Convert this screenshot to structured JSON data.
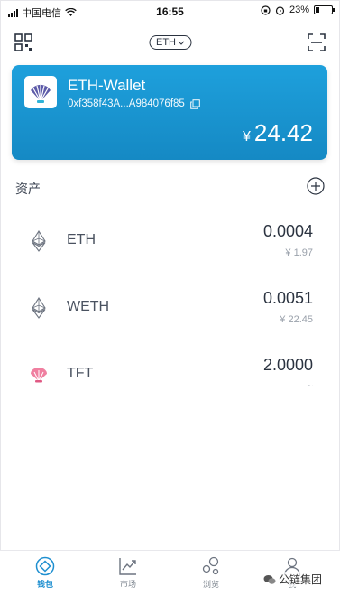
{
  "status_bar": {
    "carrier": "中国电信",
    "time": "16:55",
    "battery": "23%",
    "battery_level": 0.23
  },
  "header": {
    "network": "ETH"
  },
  "wallet": {
    "name": "ETH-Wallet",
    "address": "0xf358f43A...A984076f85",
    "currency_symbol": "¥",
    "balance": "24.42"
  },
  "assets": {
    "title": "资产",
    "items": [
      {
        "symbol": "ETH",
        "amount": "0.0004",
        "fiat": "¥ 1.97",
        "icon": "ethereum-icon"
      },
      {
        "symbol": "WETH",
        "amount": "0.0051",
        "fiat": "¥ 22.45",
        "icon": "ethereum-icon"
      },
      {
        "symbol": "TFT",
        "amount": "2.0000",
        "fiat": "~",
        "icon": "tft-token-icon"
      }
    ]
  },
  "tabs": [
    {
      "label": "钱包",
      "icon": "wallet-icon",
      "active": true
    },
    {
      "label": "市场",
      "icon": "market-chart-icon",
      "active": false
    },
    {
      "label": "浏览",
      "icon": "browse-bubbles-icon",
      "active": false
    },
    {
      "label": "我",
      "icon": "profile-icon",
      "active": false
    }
  ],
  "watermark": "公链集团",
  "colors": {
    "card_gradient_top": "#1ea0dc",
    "card_gradient_bottom": "#1589c4",
    "active_tab": "#1e8fd0"
  }
}
